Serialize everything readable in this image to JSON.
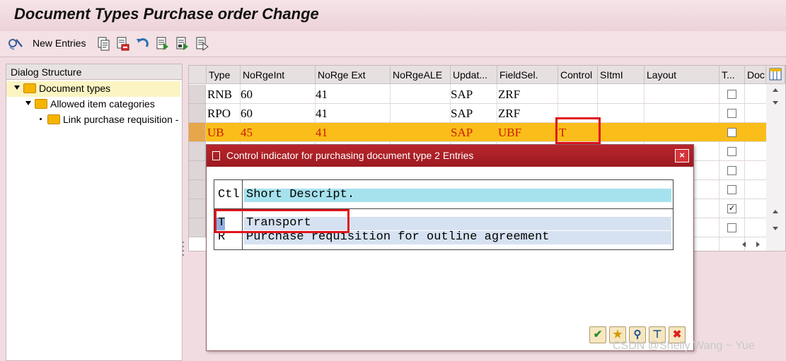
{
  "window": {
    "title": "Document Types Purchase order Change"
  },
  "toolbar": {
    "new_entries_label": "New Entries"
  },
  "dialog_structure": {
    "title": "Dialog Structure",
    "items": [
      {
        "label": "Document types"
      },
      {
        "label": "Allowed item categories"
      },
      {
        "label": "Link purchase requisition -"
      }
    ]
  },
  "grid": {
    "columns": [
      "Type",
      "NoRgeInt",
      "NoRge Ext",
      "NoRgeALE",
      "Updat...",
      "FieldSel.",
      "Control",
      "SItmI",
      "Layout",
      "T...",
      "Doc"
    ],
    "rows": [
      {
        "type": "RNB",
        "norge_int": "60",
        "norge_ext": "41",
        "norge_ale": "",
        "update": "SAP",
        "fieldsel": "ZRF",
        "control": "",
        "sitmi": "",
        "layout": ""
      },
      {
        "type": "RPO",
        "norge_int": "60",
        "norge_ext": "41",
        "norge_ale": "",
        "update": "SAP",
        "fieldsel": "ZRF",
        "control": "",
        "sitmi": "",
        "layout": ""
      },
      {
        "type": "UB",
        "norge_int": "45",
        "norge_ext": "41",
        "norge_ale": "",
        "update": "SAP",
        "fieldsel": "UBF",
        "control": "T",
        "sitmi": "",
        "layout": ""
      }
    ],
    "checkboxes": [
      false,
      false,
      false,
      false,
      false,
      false,
      true,
      false
    ],
    "highlight_color": "#fbbd1a"
  },
  "popup": {
    "title": "Control indicator for purchasing document type 2 Entries",
    "close_label": "×",
    "header": {
      "ctl": "Ctl",
      "desc": "Short Descript."
    },
    "entries": [
      {
        "ctl": "T",
        "desc": "Transport"
      },
      {
        "ctl": "R",
        "desc": "Purchase requisition for outline agreement"
      }
    ],
    "buttons": [
      {
        "icon": "checkmark-icon",
        "glyph": "✔"
      },
      {
        "icon": "star-add-icon",
        "glyph": "★"
      },
      {
        "icon": "binoculars-icon",
        "glyph": "⚲"
      },
      {
        "icon": "pin-icon",
        "glyph": "⊤"
      },
      {
        "icon": "cancel-icon",
        "glyph": "✖"
      }
    ]
  },
  "watermark": "CSDN @Shelly Wang ~ Yue",
  "colors": {
    "title_bar": "#b8262c",
    "accent_red": "#e0141c"
  }
}
